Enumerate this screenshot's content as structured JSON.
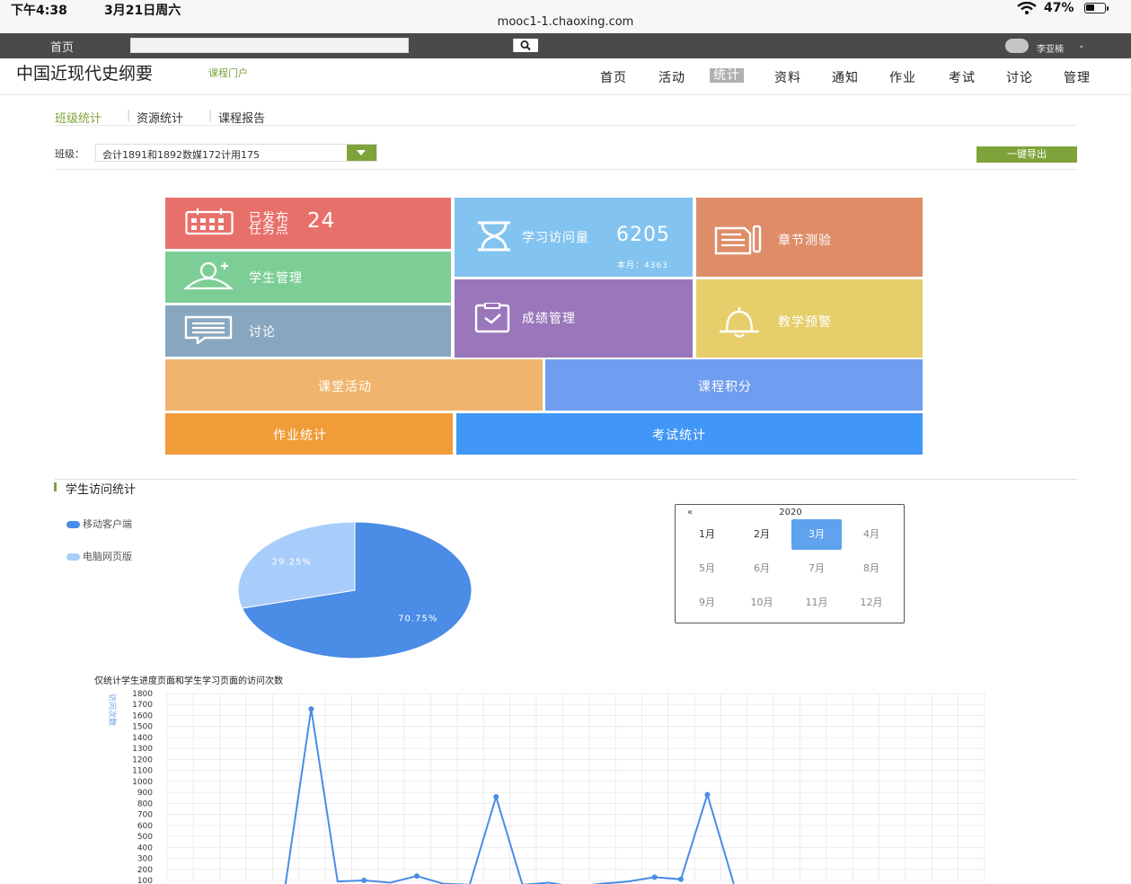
{
  "statusbar": {
    "time": "下午4:38",
    "date": "3月21日周六",
    "url": "mooc1-1.chaoxing.com",
    "battery": "47%",
    "battery_level": 0.47
  },
  "topbar": {
    "home": "首页",
    "user": "李亚楠"
  },
  "header": {
    "course_title": "中国近现代史纲要",
    "portal_link": "课程门户",
    "nav": [
      "首页",
      "活动",
      "统计",
      "资料",
      "通知",
      "作业",
      "考试",
      "讨论",
      "管理"
    ],
    "active_nav": "统计"
  },
  "subtabs": {
    "class_stats": "班级统计",
    "resource_stats": "资源统计",
    "course_report": "课程报告"
  },
  "class_filter": {
    "label": "班级：",
    "value": "会计1891和1892数媒172计用175",
    "export": "一键导出"
  },
  "tiles": {
    "published_line1": "已发布",
    "published_line2": "任务点",
    "published_count": "24",
    "visits_label": "学习访问量",
    "visits_count": "6205",
    "visits_month": "本月：4363",
    "chapter_quiz": "章节测验",
    "student_mgmt": "学生管理",
    "grade_mgmt": "成绩管理",
    "discussion": "讨论",
    "teaching_alert": "教学预警",
    "class_activity": "课堂活动",
    "course_points": "课程积分",
    "homework_stats": "作业统计",
    "exam_stats": "考试统计"
  },
  "colors": {
    "accent_green": "#7ea33a",
    "tile_red": "#e8706b",
    "tile_sky": "#83c3ef",
    "tile_orange": "#de8d68",
    "tile_green": "#7dce96",
    "tile_purple": "#9a77bb",
    "tile_slate": "#88a7bf",
    "tile_yellow": "#e6ce6b",
    "tile_peach": "#f0b46d",
    "tile_periwinkle": "#6f9def",
    "tile_amber": "#f19c38",
    "tile_blue": "#4197f5"
  },
  "visit_section": {
    "title": "学生访问统计",
    "legend": [
      "移动客户端",
      "电脑网页版"
    ]
  },
  "calendar": {
    "prev": "«",
    "year": "2020",
    "months": [
      "1月",
      "2月",
      "3月",
      "4月",
      "5月",
      "6月",
      "7月",
      "8月",
      "9月",
      "10月",
      "11月",
      "12月"
    ],
    "selected": "3月"
  },
  "line_note": "仅统计学生进度页面和学生学习页面的访问次数",
  "chart_data": [
    {
      "type": "pie",
      "slices": [
        {
          "name": "移动客户端",
          "value": 70.75,
          "label": "70.75%",
          "color": "#4a8ce6"
        },
        {
          "name": "电脑网页版",
          "value": 29.25,
          "label": "29.25%",
          "color": "#a9cdfa"
        }
      ]
    },
    {
      "type": "line",
      "ylabel": "访问次数",
      "ylim": [
        100,
        1800
      ],
      "yticks": [
        100,
        200,
        300,
        400,
        500,
        600,
        700,
        800,
        900,
        1000,
        1100,
        1200,
        1300,
        1400,
        1500,
        1600,
        1700,
        1800
      ],
      "grid": true,
      "series": [
        {
          "values": [
            20,
            1660,
            90,
            100,
            80,
            140,
            70,
            60,
            860,
            60,
            80,
            40,
            70,
            90,
            130,
            110,
            880,
            70
          ]
        }
      ],
      "color": "#4a8ce6"
    }
  ]
}
